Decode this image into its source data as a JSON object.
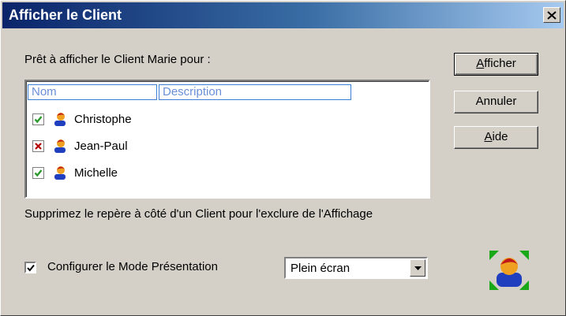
{
  "window": {
    "title": "Afficher le Client"
  },
  "prompt": "Prêt à afficher le Client Marie pour :",
  "list": {
    "columns": [
      "Nom",
      "Description"
    ],
    "rows": [
      {
        "name": "Christophe",
        "description": "",
        "state": "checked"
      },
      {
        "name": "Jean-Paul",
        "description": "",
        "state": "excluded"
      },
      {
        "name": "Michelle",
        "description": "",
        "state": "checked"
      }
    ]
  },
  "hint": "Supprimez le repère à côté d'un Client pour l'exclure de l'Affichage",
  "buttons": {
    "afficher": {
      "first": "A",
      "rest": "fficher"
    },
    "annuler": "Annuler",
    "aide": {
      "first": "A",
      "rest": "ide"
    }
  },
  "presentation": {
    "checkbox_label": "Configurer le Mode Présentation",
    "checked": true,
    "mode_selected": "Plein écran"
  },
  "icons": {
    "close": "close-icon",
    "check": "check-icon",
    "cross": "cross-icon",
    "person": "person-icon",
    "dropdown": "chevron-down-icon",
    "mode": "fullscreen-presentation-icon"
  },
  "colors": {
    "title_start": "#0a246a",
    "title_end": "#a6caf0",
    "face": "#d4d0c8",
    "check_green": "#2e9a2e",
    "cross_red": "#b40000",
    "header_blue": "#3c7fd6"
  }
}
